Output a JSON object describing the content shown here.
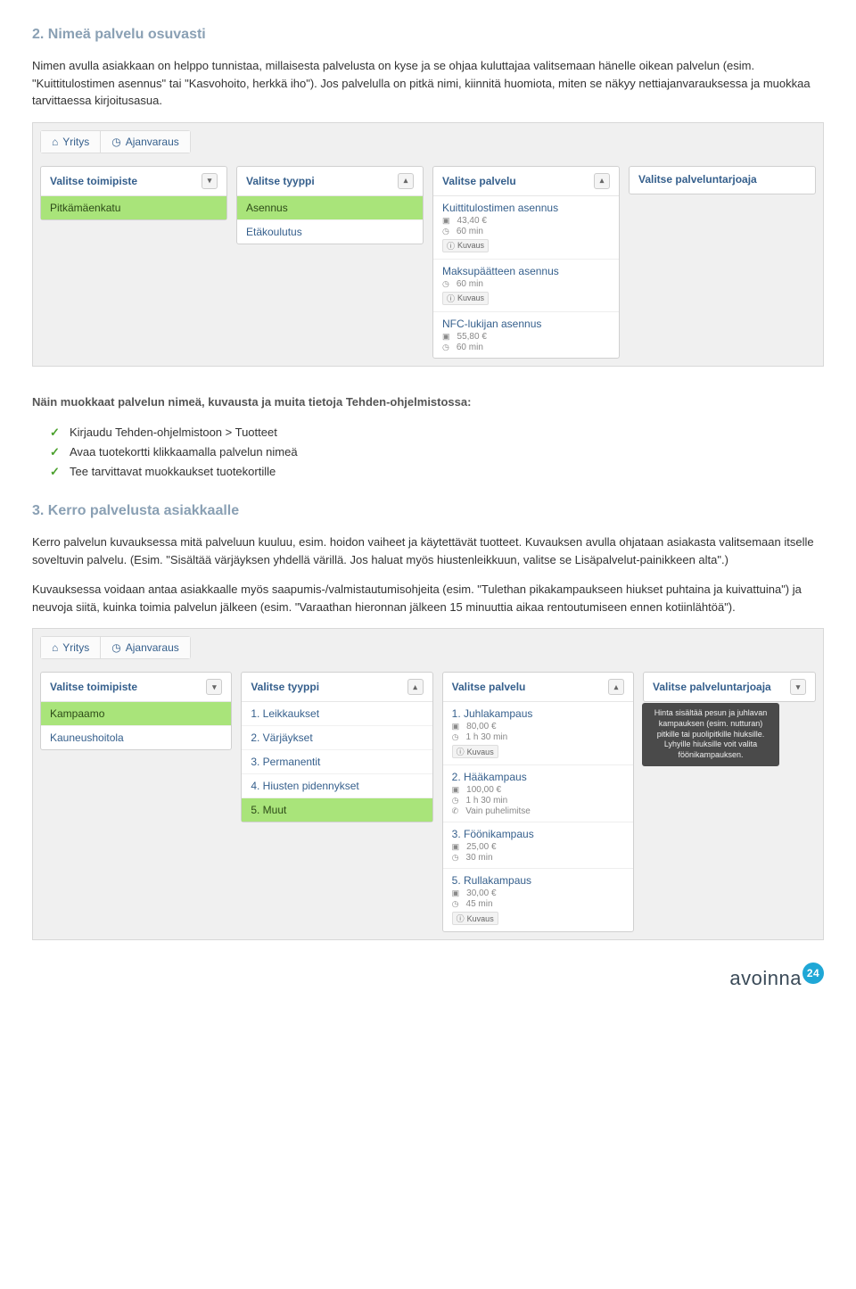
{
  "section2": {
    "title": "2. Nimeä palvelu osuvasti",
    "p1": "Nimen avulla asiakkaan on helppo tunnistaa, millaisesta palvelusta on kyse ja se ohjaa kuluttajaa valitsemaan hänelle oikean palvelun (esim. \"Kuittitulostimen asennus\" tai \"Kasvohoito, herkkä iho\"). Jos palvelulla on pitkä nimi, kiinnitä huomiota, miten se näkyy nettiajanvarauksessa ja muokkaa tarvittaessa kirjoitusasua."
  },
  "app1": {
    "tabs": {
      "yritys": "Yritys",
      "ajanvaraus": "Ajanvaraus"
    },
    "col_location": {
      "header": "Valitse toimipiste",
      "items": [
        "Pitkämäenkatu"
      ]
    },
    "col_type": {
      "header": "Valitse tyyppi",
      "items": [
        "Asennus",
        "Etäkoulutus"
      ],
      "selected": "Asennus"
    },
    "col_service": {
      "header": "Valitse palvelu",
      "items": [
        {
          "name": "Kuittitulostimen asennus",
          "price": "43,40 €",
          "dur": "60 min",
          "kuvaus": true
        },
        {
          "name": "Maksupäätteen asennus",
          "dur": "60 min",
          "kuvaus": true
        },
        {
          "name": "NFC-lukijan asennus",
          "price": "55,80 €",
          "dur": "60 min",
          "kuvaus": false
        }
      ]
    },
    "col_provider": {
      "header": "Valitse palveluntarjoaja"
    }
  },
  "instructions": {
    "lead": "Näin muokkaat palvelun nimeä, kuvausta ja muita tietoja Tehden-ohjelmistossa:",
    "items": [
      "Kirjaudu Tehden-ohjelmistoon > Tuotteet",
      "Avaa tuotekortti klikkaamalla palvelun nimeä",
      "Tee tarvittavat muokkaukset tuotekortille"
    ]
  },
  "section3": {
    "title": "3. Kerro palvelusta asiakkaalle",
    "p1": "Kerro palvelun kuvauksessa mitä palveluun kuuluu, esim. hoidon vaiheet ja käytettävät tuotteet. Kuvauksen avulla ohjataan asiakasta valitsemaan itselle soveltuvin palvelu. (Esim. \"Sisältää värjäyksen yhdellä värillä. Jos haluat myös hiustenleikkuun, valitse se Lisäpalvelut-painikkeen alta\".)",
    "p2": "Kuvauksessa voidaan antaa asiakkaalle myös saapumis-/valmistautumisohjeita (esim. \"Tulethan pikakampaukseen hiukset puhtaina ja kuivattuina\") ja neuvoja siitä, kuinka toimia palvelun jälkeen (esim. \"Varaathan hieronnan jälkeen 15 minuuttia aikaa rentoutumiseen ennen kotiinlähtöä\")."
  },
  "app2": {
    "tabs": {
      "yritys": "Yritys",
      "ajanvaraus": "Ajanvaraus"
    },
    "col_location": {
      "header": "Valitse toimipiste",
      "items": [
        "Kampaamo",
        "Kauneushoitola"
      ],
      "selected": "Kampaamo"
    },
    "col_type": {
      "header": "Valitse tyyppi",
      "items": [
        "1. Leikkaukset",
        "2. Värjäykset",
        "3. Permanentit",
        "4. Hiusten pidennykset",
        "5. Muut"
      ],
      "selected": "5. Muut"
    },
    "col_service": {
      "header": "Valitse palvelu",
      "items": [
        {
          "name": "1. Juhlakampaus",
          "price": "80,00 €",
          "dur": "1 h 30 min",
          "kuvaus": true
        },
        {
          "name": "2. Hääkampaus",
          "price": "100,00 €",
          "dur": "1 h 30 min",
          "note": "Vain puhelimitse"
        },
        {
          "name": "3. Föönikampaus",
          "price": "25,00 €",
          "dur": "30 min"
        },
        {
          "name": "5. Rullakampaus",
          "price": "30,00 €",
          "dur": "45 min",
          "kuvaus": true
        }
      ]
    },
    "col_provider": {
      "header": "Valitse palveluntarjoaja",
      "tooltip": "Hinta sisältää pesun ja juhlavan kampauksen (esim. nutturan) pitkille tai puolipitkille hiuksille. Lyhyille hiuksille voit valita föönikampauksen."
    }
  },
  "ui": {
    "kuvaus_label": "Kuvaus"
  },
  "logo": {
    "text": "avoinna",
    "badge": "24"
  }
}
